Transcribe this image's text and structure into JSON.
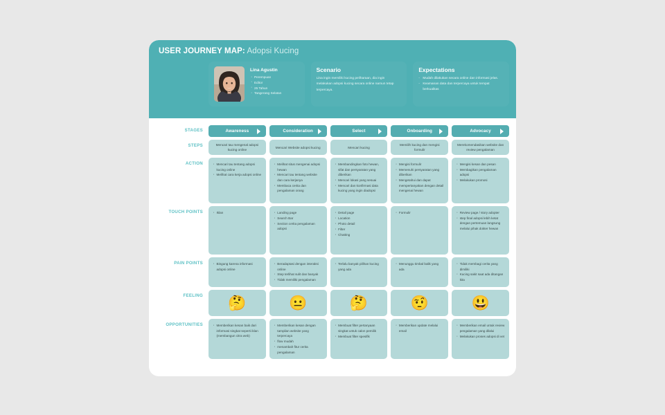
{
  "header": {
    "title_strong": "USER JOURNEY MAP:",
    "title_light": "Adopsi Kucing",
    "persona": {
      "name": "Lina Agustin",
      "avatar_alt": "persona-photo",
      "details": [
        "Perempuan",
        "Editor",
        "25 Tahun",
        "Tangerang Selatan"
      ]
    },
    "scenario": {
      "title": "Scenario",
      "text": "Lina ingin memiliki kucing peliharaan, dia ingin melakukan adopsi kucing secara online namun tetap terpercaya."
    },
    "expectations": {
      "title": "Expectations",
      "items": [
        "Mudah dilakukan secara online dan informasi jelas.",
        "Keamanan data dan terpercaya untuk tempat berkualitas"
      ]
    }
  },
  "row_labels": {
    "stages": "STAGES",
    "steps": "STEPS",
    "action": "ACTION",
    "touch_points": "TOUCH POINTS",
    "pain_points": "PAIN POINTS",
    "feeling": "FEELING",
    "opportunities": "OPPORTUNITIES"
  },
  "stages": [
    {
      "label": "Awareness"
    },
    {
      "label": "Consideration"
    },
    {
      "label": "Select"
    },
    {
      "label": "Onboarding"
    },
    {
      "label": "Advocacy"
    }
  ],
  "steps": [
    "Mencari tau mengenal adopsi kucing online",
    "Mencari Website adopsi kucing",
    "Mencari kucing",
    "Memilih kucing dan mengisi formulir",
    "Merekomendasikan website dan review pengalaman"
  ],
  "action": [
    [
      "Mencari tau tentang adopsi kucing online",
      "Melihat cara kerja adopsi online"
    ],
    [
      "Melihat situs mengenai adopsi hewan",
      "Mencari tau tentang website dan cara kerjanya",
      "Membaca cerita dan pengalaman orang"
    ],
    [
      "Membandingkan foto hewan, sifat dan persyaratan yang diberikan",
      "Mencari lokasi yang sesuai",
      "Mencari dan konfirmasi data kucing yang ingin diadopsi"
    ],
    [
      "Mengisi formulir",
      "Memenuhi persyaratan yang diberikan",
      "Mengetahui dan dapat mempertanyakan dengan detail mengenai hewan"
    ],
    [
      "Mengisi kesan dan pesan",
      "Membagikan pengalaman adopsi",
      "Melakukan promosi"
    ]
  ],
  "touch_points": [
    [
      "Iklan"
    ],
    [
      "Landing page",
      "Search Bar",
      "Section cerita pengalaman adopsi"
    ],
    [
      "Detail page",
      "Location",
      "Photo detail",
      "Filter",
      "Chatting"
    ],
    [
      "Formulir"
    ],
    [
      "Review page / story adopter",
      "step final adopsi lebih ketat dengan pertemuan langsung melalui pihak dokter hewan"
    ]
  ],
  "pain_points": [
    [
      "Bingung karena informasi adopsi online"
    ],
    [
      "Beradaptasi dengan interaksi online",
      "Step terlihat sulit dan banyak",
      "Tidak memiliki pengalaman"
    ],
    [
      "Terlalu banyak pilihan kucing yang ada"
    ],
    [
      "Menunggu timbal balik yang ada"
    ],
    [
      "Tidak membagi cerita yang dimiliki",
      "Kucing sakit saat ada ditangan kita"
    ]
  ],
  "feeling": [
    {
      "icon": "thinking-face-emoji",
      "glyph": "🤔"
    },
    {
      "icon": "neutral-face-emoji",
      "glyph": "😐"
    },
    {
      "icon": "thinking-face-emoji",
      "glyph": "🤔"
    },
    {
      "icon": "raised-eyebrow-face-emoji",
      "glyph": "🤨"
    },
    {
      "icon": "grinning-face-emoji",
      "glyph": "😃"
    }
  ],
  "opportunities": [
    [
      "Memberikan kesan baik dari informasi singkat seperti iklan (membangun citra web)"
    ],
    [
      "Memberikan kesan dengan tampilan website yang terpercaya",
      "flow mudah",
      "menambah fitur cerita pengalaman"
    ],
    [
      "Membuat filter pertanyaan singkat untuk calon pemilik",
      "Membuat filter spesifik"
    ],
    [
      "Memberikan update melalui email"
    ],
    [
      "Memberikan email untuk review pengalaman yang dilalui",
      "Melakukan proses adopsi di vet"
    ]
  ],
  "colors": {
    "header_teal": "#4fb0b4",
    "card_teal": "#55b2b6",
    "stage_teal": "#54adb1",
    "cell_mint": "#b4d8d8",
    "label_teal": "#5cc0c4",
    "page_bg": "#e8e8e8",
    "board_bg": "#ffffff"
  }
}
